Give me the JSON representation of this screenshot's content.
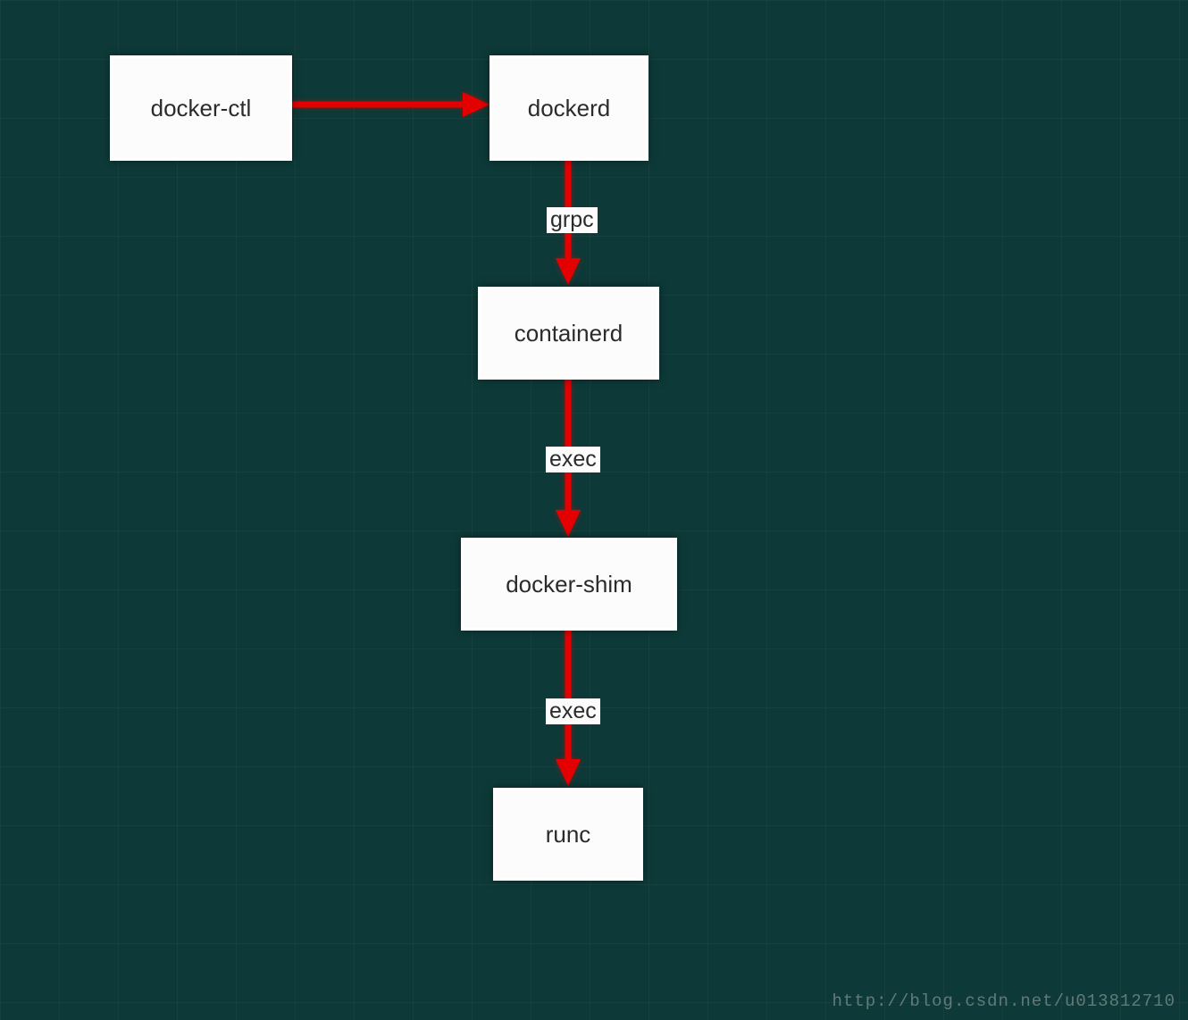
{
  "nodes": {
    "docker_ctl": "docker-ctl",
    "dockerd": "dockerd",
    "containerd": "containerd",
    "docker_shim": "docker-shim",
    "runc": "runc"
  },
  "edges": {
    "dockerd_to_containerd": "grpc",
    "containerd_to_shim": "exec",
    "shim_to_runc": "exec"
  },
  "watermark": "http://blog.csdn.net/u013812710",
  "diagram_type": "flowchart",
  "chart_data": {
    "type": "flowchart",
    "nodes": [
      {
        "id": "docker-ctl",
        "label": "docker-ctl"
      },
      {
        "id": "dockerd",
        "label": "dockerd"
      },
      {
        "id": "containerd",
        "label": "containerd"
      },
      {
        "id": "docker-shim",
        "label": "docker-shim"
      },
      {
        "id": "runc",
        "label": "runc"
      }
    ],
    "edges": [
      {
        "from": "docker-ctl",
        "to": "dockerd",
        "label": ""
      },
      {
        "from": "dockerd",
        "to": "containerd",
        "label": "grpc"
      },
      {
        "from": "containerd",
        "to": "docker-shim",
        "label": "exec"
      },
      {
        "from": "docker-shim",
        "to": "runc",
        "label": "exec"
      }
    ],
    "colors": {
      "background": "#0d3a38",
      "node_fill": "#fcfcfc",
      "arrow": "#e40000"
    }
  }
}
